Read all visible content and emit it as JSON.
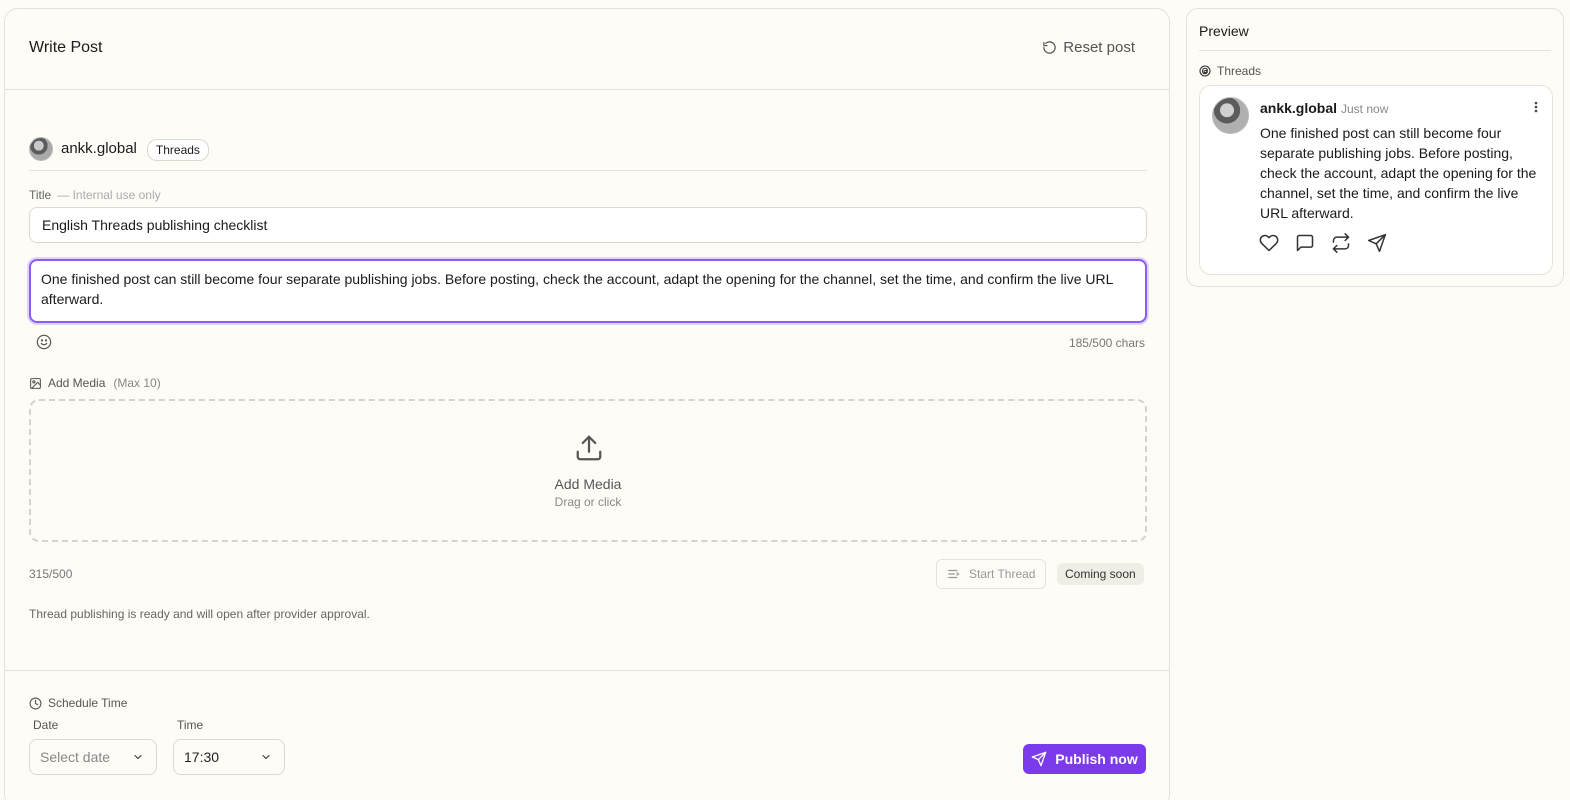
{
  "editor": {
    "title": "Write Post",
    "reset_label": "Reset post",
    "account": {
      "name": "ankk.global",
      "platform": "Threads"
    },
    "title_field": {
      "label": "Title",
      "hint": "— Internal use only",
      "value": "English Threads publishing checklist"
    },
    "body": {
      "value": "One finished post can still become four separate publishing jobs. Before posting, check the account, adapt the opening for the channel, set the time, and confirm the live URL afterward.",
      "char_count": "185/500 chars"
    },
    "media": {
      "label": "Add Media",
      "max": "(Max 10)",
      "drop_title": "Add Media",
      "drop_sub": "Drag or click"
    },
    "thread": {
      "count": "315/500",
      "start_label": "Start Thread",
      "badge": "Coming soon",
      "note": "Thread publishing is ready and will open after provider approval."
    },
    "schedule": {
      "label": "Schedule Time",
      "date_label": "Date",
      "date_placeholder": "Select date",
      "time_label": "Time",
      "time_value": "17:30"
    },
    "publish_label": "Publish now"
  },
  "preview": {
    "title": "Preview",
    "platform": "Threads",
    "card": {
      "name": "ankk.global",
      "time": "Just now",
      "text": "One finished post can still become four separate publishing jobs. Before posting, check the account, adapt the opening for the channel, set the time, and confirm the live URL afterward."
    }
  },
  "colors": {
    "accent": "#7c3aed",
    "focus_border": "#8b5cf6",
    "background": "#fdfcf7"
  },
  "icons": [
    "reset-icon",
    "emoji-icon",
    "image-icon",
    "upload-icon",
    "thread-lines-icon",
    "clock-icon",
    "chevron-down-icon",
    "send-icon",
    "threads-logo-icon",
    "more-vertical-icon",
    "heart-icon",
    "comment-icon",
    "repost-icon",
    "share-icon"
  ]
}
